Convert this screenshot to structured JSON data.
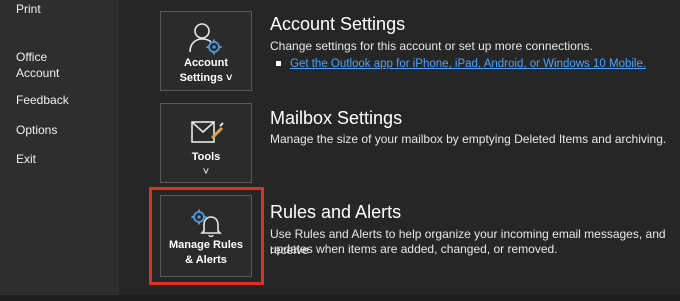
{
  "sidebar": {
    "items": [
      {
        "label": "Print"
      },
      {
        "label": "Office\nAccount"
      },
      {
        "label": "Feedback"
      },
      {
        "label": "Options"
      },
      {
        "label": "Exit"
      }
    ]
  },
  "sections": {
    "account": {
      "title": "Account Settings",
      "description": "Change settings for this account or set up more connections.",
      "link": "Get the Outlook app for iPhone, iPad, Android, or Windows 10 Mobile.",
      "tile_line1": "Account",
      "tile_line2": "Settings ˅",
      "icon": "account-settings-icon"
    },
    "mailbox": {
      "title": "Mailbox Settings",
      "description": "Manage the size of your mailbox by emptying Deleted Items and archiving.",
      "tile_line1": "Tools",
      "tile_line2": "˅",
      "icon": "tools-mailbox-icon"
    },
    "rules": {
      "title": "Rules and Alerts",
      "description_line1": "Use Rules and Alerts to help organize your incoming email messages, and receive",
      "description_line2": "updates when items are added, changed, or removed.",
      "tile_line1": "Manage Rules",
      "tile_line2": "& Alerts",
      "icon": "manage-rules-alerts-icon"
    }
  },
  "colors": {
    "accent_link": "#4aa3ff",
    "highlight": "#e0311e",
    "icon_blue": "#4f9be0"
  }
}
